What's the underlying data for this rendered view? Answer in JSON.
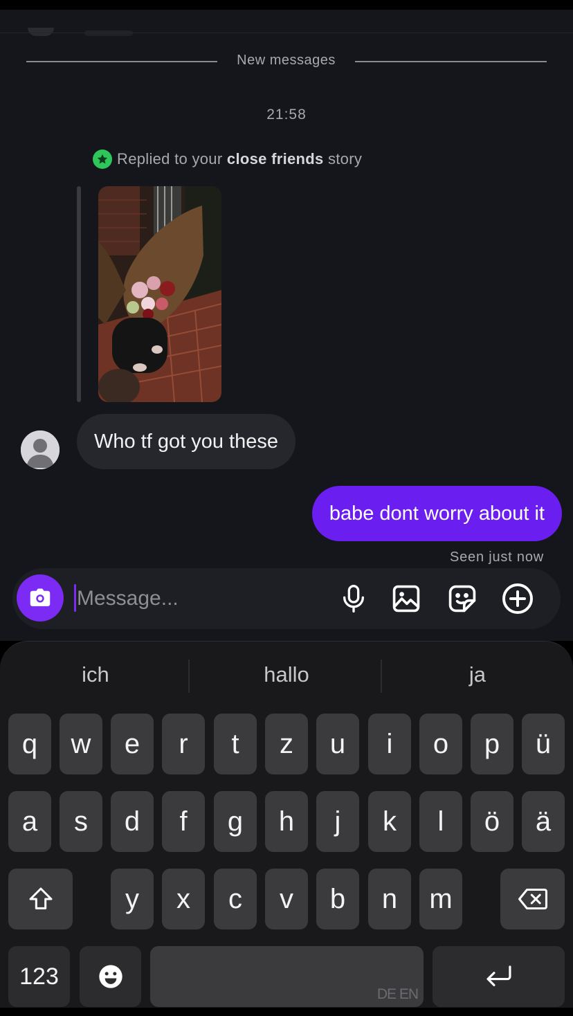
{
  "chat": {
    "new_messages_label": "New messages",
    "timestamp": "21:58",
    "story_reply": {
      "prefix": "Replied to your ",
      "highlight": "close friends",
      "suffix": " story"
    },
    "messages": [
      {
        "direction": "incoming",
        "text": "Who tf got you these"
      },
      {
        "direction": "outgoing",
        "text": "babe dont worry about it"
      }
    ],
    "seen_status": "Seen just now"
  },
  "composer": {
    "placeholder": "Message..."
  },
  "keyboard": {
    "suggestions": [
      "ich",
      "hallo",
      "ja"
    ],
    "row1": [
      "q",
      "w",
      "e",
      "r",
      "t",
      "z",
      "u",
      "i",
      "o",
      "p",
      "ü"
    ],
    "row2": [
      "a",
      "s",
      "d",
      "f",
      "g",
      "h",
      "j",
      "k",
      "l",
      "ö",
      "ä"
    ],
    "row3": [
      "y",
      "x",
      "c",
      "v",
      "b",
      "n",
      "m"
    ],
    "numbers_key": "123",
    "space_language": "DE EN"
  },
  "colors": {
    "accent_purple": "#6a1ef0",
    "close_friends_green": "#2ec55a",
    "background": "#15161b"
  }
}
